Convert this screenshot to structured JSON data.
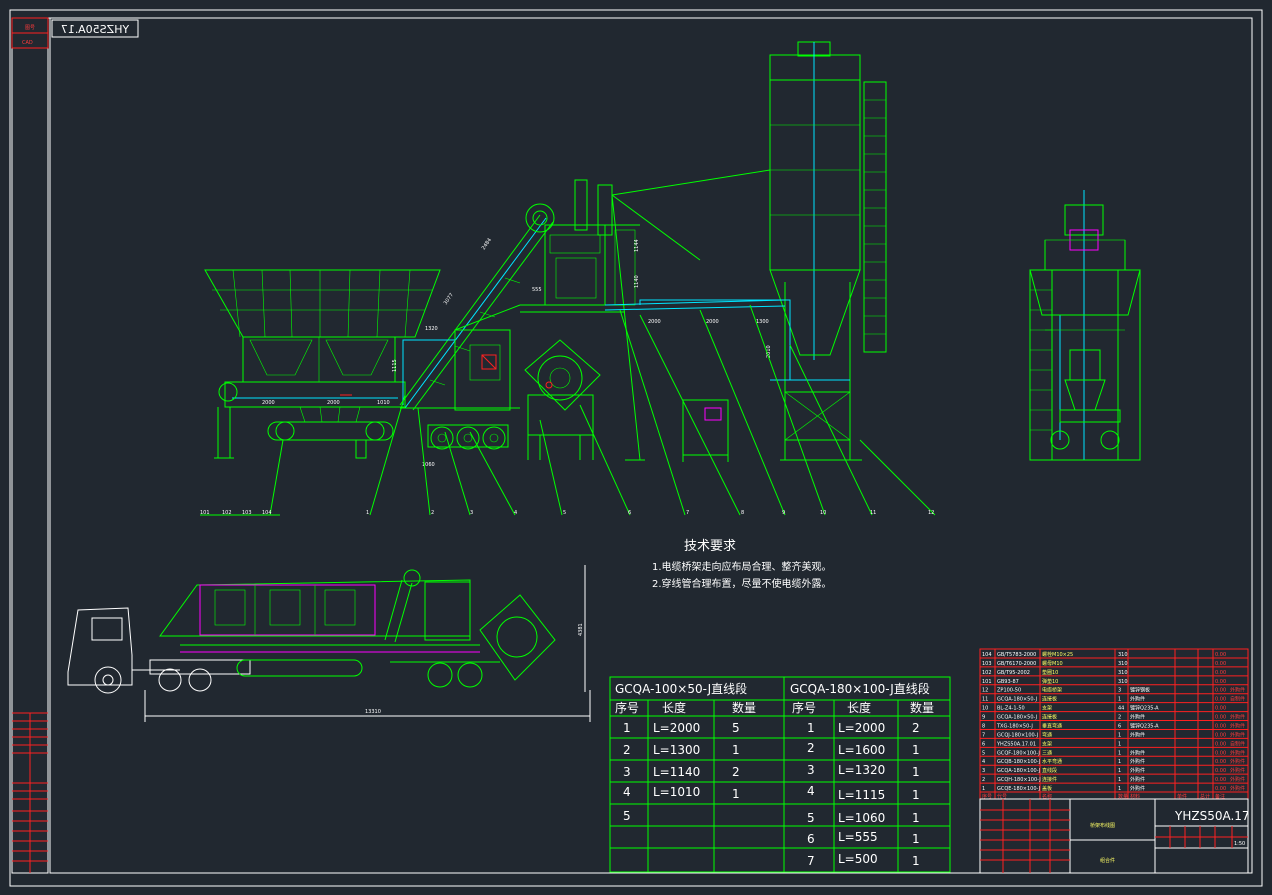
{
  "drawing": {
    "code_mirrored": "YHZS50A.17",
    "stamp_labels": [
      "图号",
      "CAD"
    ],
    "dimensions_main": [
      "2484",
      "3077",
      "1320",
      "1115",
      "2000",
      "2000",
      "1010",
      "1060",
      "1144",
      "1140",
      "555",
      "2000",
      "2000",
      "1300",
      "2010"
    ],
    "dimensions_truck": [
      "13310",
      "4381"
    ],
    "balloons_left": [
      "101",
      "102",
      "103",
      "104"
    ],
    "balloons": [
      "1",
      "2",
      "3",
      "4",
      "5",
      "6",
      "7",
      "8",
      "9",
      "10",
      "11",
      "12"
    ]
  },
  "tech_requirements": {
    "title": "技术要求",
    "items": [
      "1.电缆桥架走向应布局合理、整齐美观。",
      "2.穿线管合理布置，尽量不使电缆外露。"
    ]
  },
  "tray_table_1": {
    "title": "GCQA-100×50-J直线段",
    "headers": [
      "序号",
      "长度",
      "数量"
    ],
    "rows": [
      [
        "1",
        "L=2000",
        "5"
      ],
      [
        "2",
        "L=1300",
        "1"
      ],
      [
        "3",
        "L=1140",
        "2"
      ],
      [
        "4",
        "L=1010",
        "1"
      ],
      [
        "5",
        "",
        ""
      ]
    ]
  },
  "tray_table_2": {
    "title": "GCQA-180×100-J直线段",
    "headers": [
      "序号",
      "长度",
      "数量"
    ],
    "rows": [
      [
        "1",
        "L=2000",
        "2"
      ],
      [
        "2",
        "L=1600",
        "1"
      ],
      [
        "3",
        "L=1320",
        "1"
      ],
      [
        "4",
        "L=1115",
        "1"
      ],
      [
        "5",
        "L=1060",
        "1"
      ],
      [
        "6",
        "L=555",
        "1"
      ],
      [
        "7",
        "L=500",
        "1"
      ]
    ]
  },
  "bom": {
    "rows": [
      [
        "104",
        "GB/T5783-2000",
        "螺栓M10×25",
        "310",
        "",
        "",
        "",
        "0.00",
        ""
      ],
      [
        "103",
        "GB/T6170-2000",
        "螺母M10",
        "310",
        "",
        "",
        "",
        "0.00",
        ""
      ],
      [
        "102",
        "GB/T95-2002",
        "垫圈10",
        "310",
        "",
        "",
        "",
        "0.00",
        ""
      ],
      [
        "101",
        "GB93-87",
        "弹垫10",
        "310",
        "",
        "",
        "",
        "0.00",
        ""
      ],
      [
        "12",
        "ZP100-50",
        "电缆桥架",
        "3",
        "镀锌钢板",
        "",
        "",
        "0.00",
        "外购件"
      ],
      [
        "11",
        "GCQA-180×50-J",
        "连接板",
        "1",
        "外购件",
        "",
        "",
        "0.00",
        "自制件"
      ],
      [
        "10",
        "BL-Z4-1-50",
        "支架",
        "44",
        "镀锌Q235-A",
        "",
        "",
        "0.00",
        ""
      ],
      [
        "9",
        "GCQA-180×50-J",
        "连接板",
        "2",
        "外购件",
        "",
        "",
        "0.00",
        "外购件"
      ],
      [
        "8",
        "TXG-180×50-J",
        "垂直弯通",
        "6",
        "镀锌Q235-A",
        "",
        "",
        "0.00",
        "外购件"
      ],
      [
        "7",
        "GCQJ-180×100-J",
        "弯通",
        "1",
        "外购件",
        "",
        "",
        "0.00",
        "外购件"
      ],
      [
        "6",
        "YHZS50A.17.01",
        "支架",
        "1",
        "",
        "",
        "",
        "0.00",
        "自制件"
      ],
      [
        "5",
        "GCQF-180×100-J",
        "三通",
        "1",
        "外购件",
        "",
        "",
        "0.00",
        "外购件"
      ],
      [
        "4",
        "GCQB-180×100-J",
        "水平弯通",
        "1",
        "外购件",
        "",
        "",
        "0.00",
        "外购件"
      ],
      [
        "3",
        "GCQA-180×100-J",
        "直线段",
        "1",
        "外购件",
        "",
        "",
        "0.00",
        "外购件"
      ],
      [
        "2",
        "GCQH-180×100-J",
        "连接件",
        "1",
        "外购件",
        "",
        "",
        "0.00",
        "外购件"
      ],
      [
        "1",
        "GCQE-180×100-J",
        "盖板",
        "1",
        "外购件",
        "",
        "",
        "0.00",
        "外购件"
      ]
    ],
    "header": [
      "序号",
      "代号",
      "名称",
      "数量",
      "材料",
      "单件",
      "总计",
      "备注"
    ]
  },
  "title_block": {
    "drawing_no": "YHZS50A.17",
    "name": "桥架布线图",
    "subtitle": "组合件",
    "scale": "1:50"
  },
  "colors": {
    "background": "#212830",
    "frame": "#ffffff",
    "structure": "#00ff00",
    "tray": "#00e5ff",
    "alt": "#ff00ff",
    "red": "#ff2020",
    "text_yellow": "#ffff66"
  }
}
